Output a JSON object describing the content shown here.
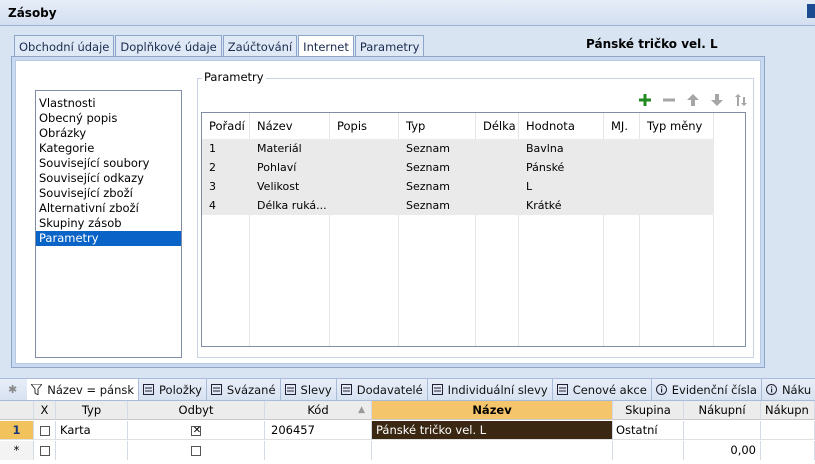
{
  "window": {
    "title": "Zásoby"
  },
  "tabs": [
    {
      "label": "Obchodní údaje"
    },
    {
      "label": "Doplňkové údaje"
    },
    {
      "label": "Zaúčtování"
    },
    {
      "label": "Internet"
    },
    {
      "label": "Parametry"
    }
  ],
  "active_tab": "Internet",
  "product_title": "Pánské tričko vel. L",
  "group_label": "Parametry",
  "nav_items": [
    {
      "label": "Vlastnosti"
    },
    {
      "label": "Obecný popis"
    },
    {
      "label": "Obrázky"
    },
    {
      "label": "Kategorie"
    },
    {
      "label": "Související soubory"
    },
    {
      "label": "Související odkazy"
    },
    {
      "label": "Související zboží"
    },
    {
      "label": "Alternativní zboží"
    },
    {
      "label": "Skupiny zásob"
    },
    {
      "label": "Parametry"
    }
  ],
  "selected_nav": "Parametry",
  "toolbar_icons": [
    "add-icon",
    "remove-icon",
    "move-top-icon",
    "move-down-icon",
    "sort-icon"
  ],
  "params_table": {
    "headers": [
      "Pořadí",
      "Název",
      "Popis",
      "Typ",
      "Délka",
      "Hodnota",
      "MJ.",
      "Typ měny"
    ],
    "rows": [
      [
        "1",
        "Materiál",
        "",
        "Seznam",
        "",
        "Bavlna",
        "",
        ""
      ],
      [
        "2",
        "Pohlaví",
        "",
        "Seznam",
        "",
        "Pánské",
        "",
        ""
      ],
      [
        "3",
        "Velikost",
        "",
        "Seznam",
        "",
        "L",
        "",
        ""
      ],
      [
        "4",
        "Délka ruká...",
        "",
        "Seznam",
        "",
        "Krátké",
        "",
        ""
      ]
    ]
  },
  "bottom_tabs": [
    {
      "label": "Název = pánsk",
      "icon": "filter-icon"
    },
    {
      "label": "Položky",
      "icon": "list-icon"
    },
    {
      "label": "Svázané",
      "icon": "list-icon"
    },
    {
      "label": "Slevy",
      "icon": "list-icon"
    },
    {
      "label": "Dodavatelé",
      "icon": "list-icon"
    },
    {
      "label": "Individuální slevy",
      "icon": "list-icon"
    },
    {
      "label": "Cenové akce",
      "icon": "list-icon"
    },
    {
      "label": "Evidenční čísla",
      "icon": "info-icon"
    },
    {
      "label": "Náku",
      "icon": "info-icon"
    }
  ],
  "bottom_tabs_star": "✱",
  "bottom_grid": {
    "headers": [
      "",
      "X",
      "Typ",
      "Odbyt",
      "Kód",
      "Název",
      "Skupina",
      "Nákupní",
      "Nákupn"
    ],
    "row1": {
      "mark": "1",
      "typ": "Karta",
      "kod": "206457",
      "nazev": "Pánské tričko vel. L",
      "skupina": "Ostatní"
    },
    "row2": {
      "mark": "*",
      "nakupni": "0,00"
    }
  }
}
